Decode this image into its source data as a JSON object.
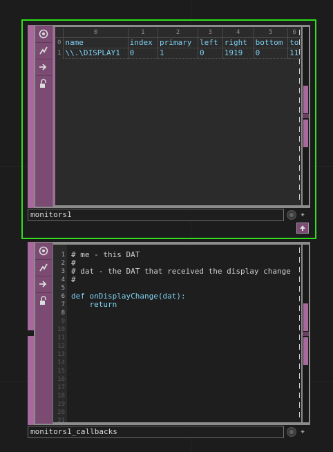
{
  "colors": {
    "selection": "#31e01b",
    "node_frame": "#8c8c8c",
    "dat_strip": "#a8699c",
    "cell_text": "#7ecff0",
    "background": "#1c1c1c"
  },
  "node1": {
    "name": "monitors1",
    "tools": [
      "viewer-active-icon",
      "bypass-icon",
      "display-flag-icon",
      "lock-icon"
    ],
    "table": {
      "col_indices": [
        "0",
        "1",
        "2",
        "3",
        "4",
        "5",
        "6"
      ],
      "row_indices": [
        "0",
        "1"
      ],
      "header_row": [
        "name",
        "index",
        "primary",
        "left",
        "right",
        "bottom",
        "to"
      ],
      "data_row": [
        "\\\\.\\DISPLAY1",
        "0",
        "1",
        "0",
        "1919",
        "0",
        "11"
      ]
    }
  },
  "node2": {
    "name": "monitors1_callbacks",
    "tools": [
      "viewer-active-icon",
      "bypass-icon",
      "display-flag-icon",
      "lock-icon"
    ],
    "code": {
      "lines": [
        {
          "n": "1",
          "text": "# me - this DAT",
          "type": "comment",
          "dim": false
        },
        {
          "n": "2",
          "text": "#",
          "type": "comment",
          "dim": false
        },
        {
          "n": "3",
          "text": "# dat - the DAT that received the display change",
          "type": "comment",
          "dim": false
        },
        {
          "n": "4",
          "text": "#",
          "type": "comment",
          "dim": false
        },
        {
          "n": "5",
          "text": "",
          "type": "plain",
          "dim": false
        },
        {
          "n": "6",
          "text": "def onDisplayChange(dat):",
          "type": "kw",
          "dim": false
        },
        {
          "n": "7",
          "text": "    return",
          "type": "kw",
          "dim": false
        },
        {
          "n": "8",
          "text": "",
          "type": "plain",
          "dim": false
        },
        {
          "n": "9",
          "text": "",
          "type": "plain",
          "dim": true
        },
        {
          "n": "10",
          "text": "",
          "type": "plain",
          "dim": true
        },
        {
          "n": "11",
          "text": "",
          "type": "plain",
          "dim": true
        },
        {
          "n": "12",
          "text": "",
          "type": "plain",
          "dim": true
        },
        {
          "n": "13",
          "text": "",
          "type": "plain",
          "dim": true
        },
        {
          "n": "14",
          "text": "",
          "type": "plain",
          "dim": true
        },
        {
          "n": "15",
          "text": "",
          "type": "plain",
          "dim": true
        },
        {
          "n": "16",
          "text": "",
          "type": "plain",
          "dim": true
        },
        {
          "n": "17",
          "text": "",
          "type": "plain",
          "dim": true
        },
        {
          "n": "18",
          "text": "",
          "type": "plain",
          "dim": true
        },
        {
          "n": "19",
          "text": "",
          "type": "plain",
          "dim": true
        },
        {
          "n": "20",
          "text": "",
          "type": "plain",
          "dim": true
        },
        {
          "n": "21",
          "text": "",
          "type": "plain",
          "dim": true
        }
      ]
    }
  }
}
